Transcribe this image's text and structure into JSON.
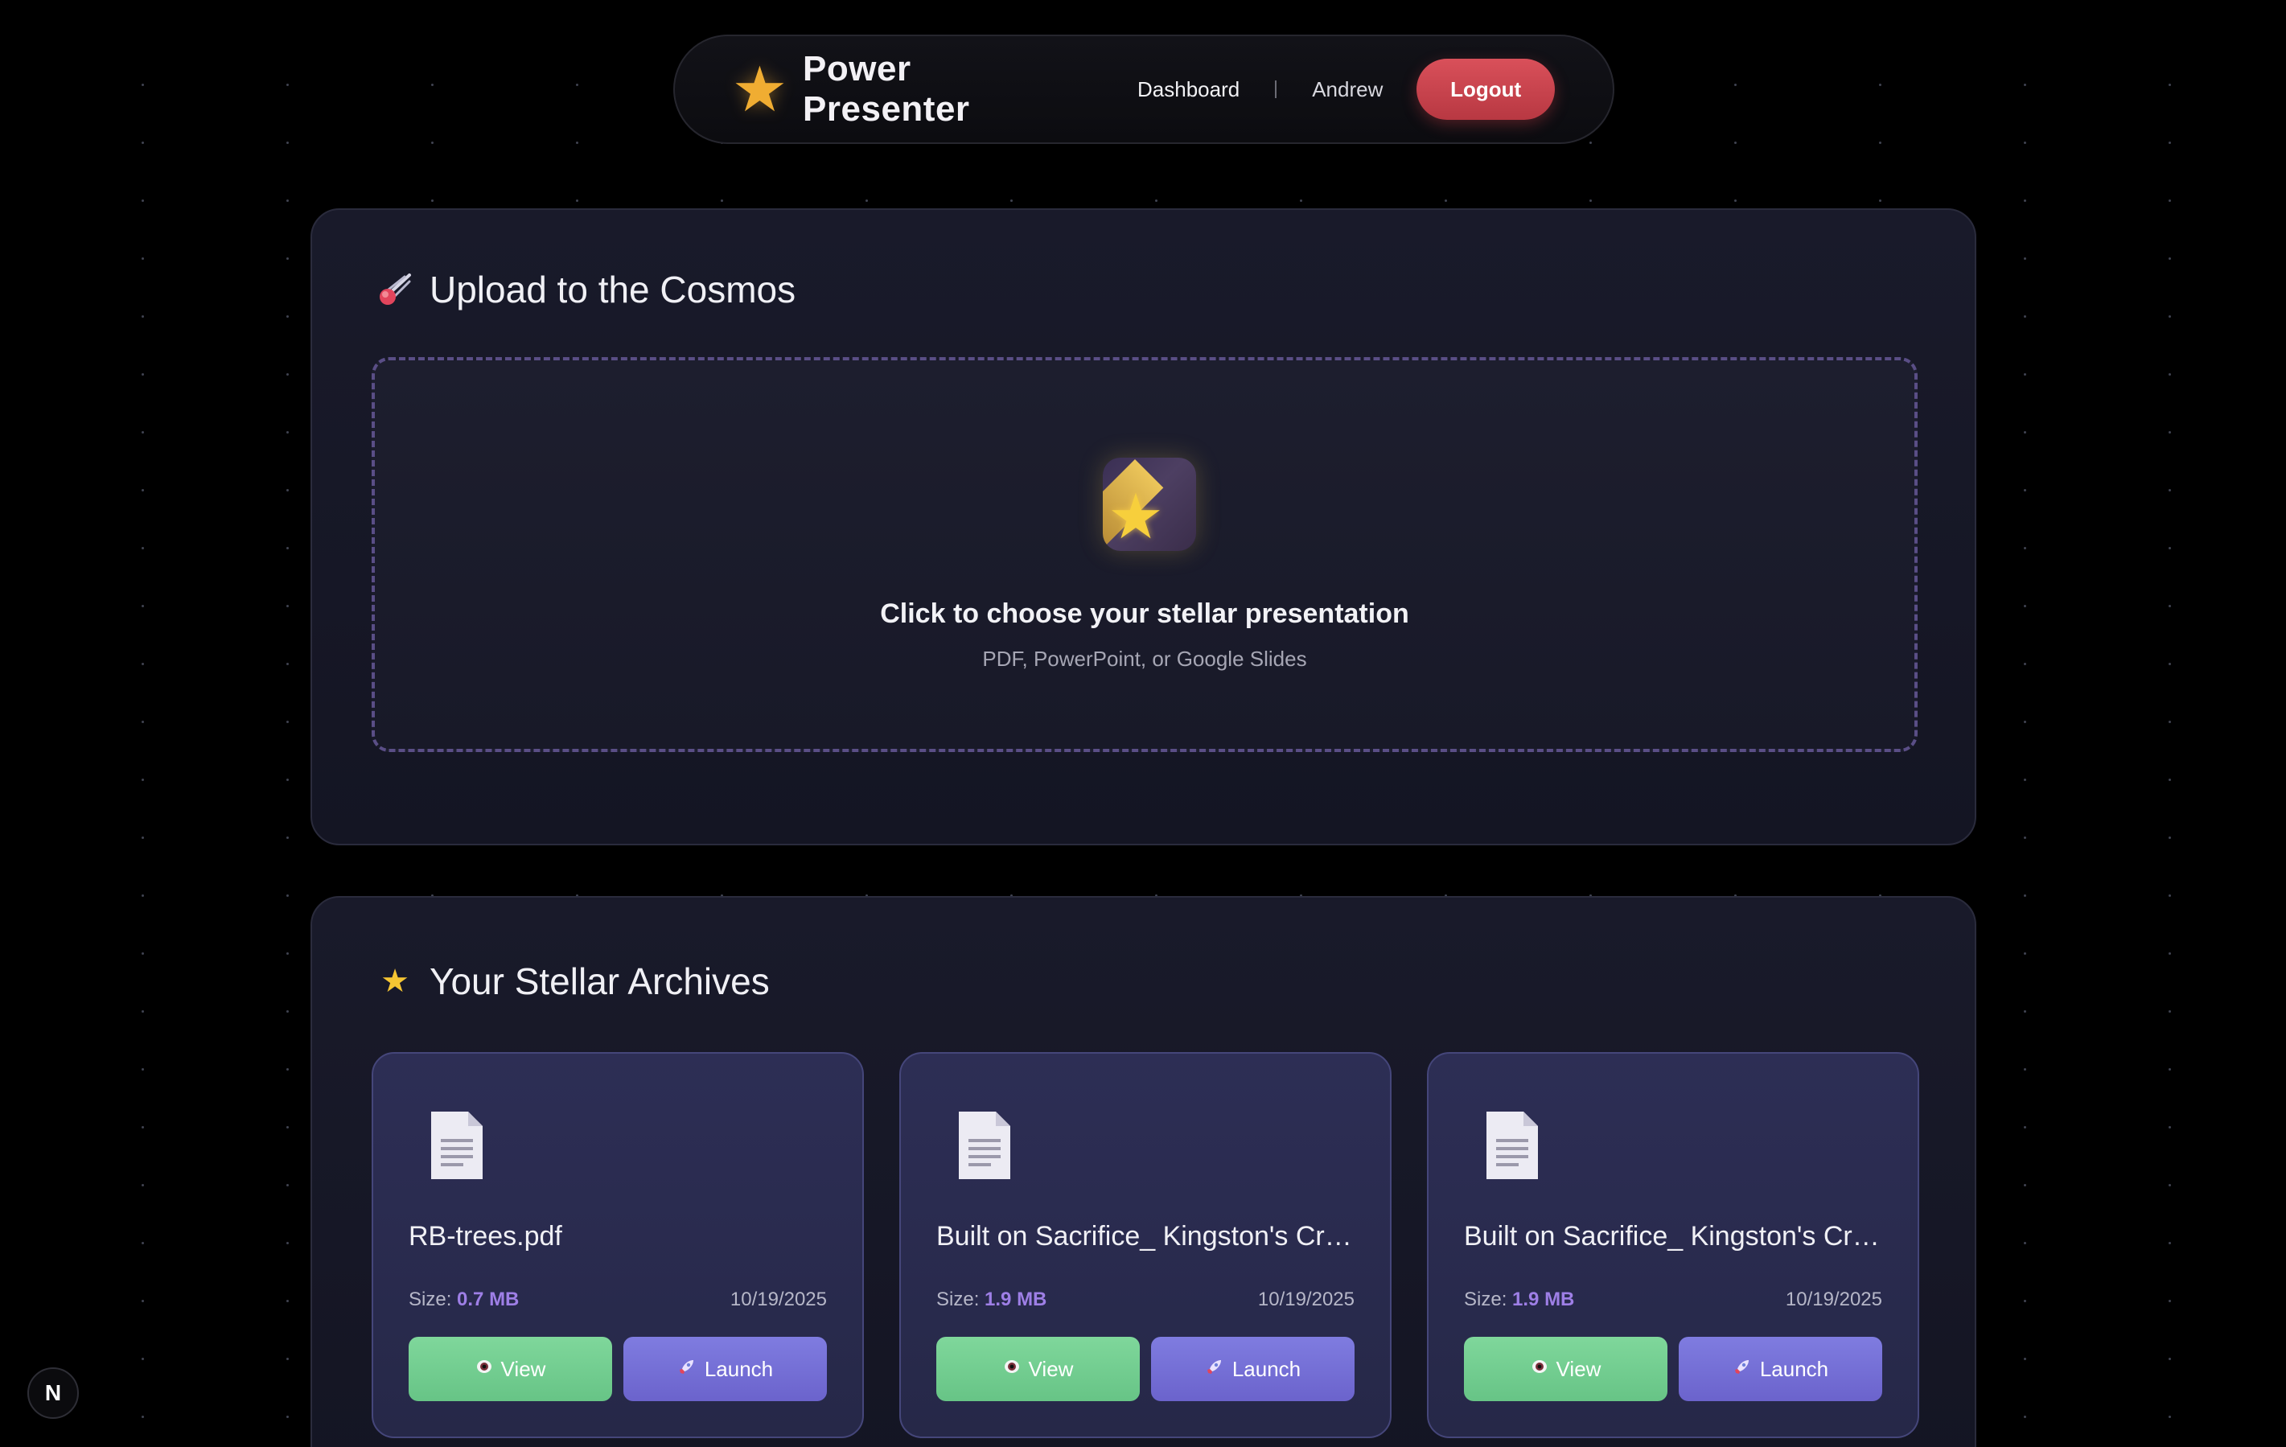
{
  "nav": {
    "brand": "Power Presenter",
    "brand_icon": "star-icon",
    "dashboard_label": "Dashboard",
    "separator": "|",
    "username": "Andrew",
    "logout_label": "Logout"
  },
  "upload": {
    "title": "Upload to the Cosmos",
    "title_icon": "comet-icon",
    "dropzone_icon": "shooting-star-icon",
    "dropzone_title": "Click to choose your stellar presentation",
    "dropzone_subtitle": "PDF, PowerPoint, or Google Slides"
  },
  "archive": {
    "title": "Your Stellar Archives",
    "title_icon": "star-icon",
    "size_prefix": "Size: ",
    "view_label": "View",
    "launch_label": "Launch",
    "files": [
      {
        "name": "RB-trees.pdf",
        "size": "0.7 MB",
        "date": "10/19/2025"
      },
      {
        "name": "Built on Sacrifice_ Kingston's Crit...",
        "size": "1.9 MB",
        "date": "10/19/2025"
      },
      {
        "name": "Built on Sacrifice_ Kingston's Crit...",
        "size": "1.9 MB",
        "date": "10/19/2025"
      }
    ]
  },
  "dev_badge": "N",
  "colors": {
    "logout": "#c8434d",
    "view_button": "#72cd90",
    "launch_button": "#7570d8",
    "accent_size": "#9e7fe6",
    "dropzone_border": "#5a4e86"
  }
}
